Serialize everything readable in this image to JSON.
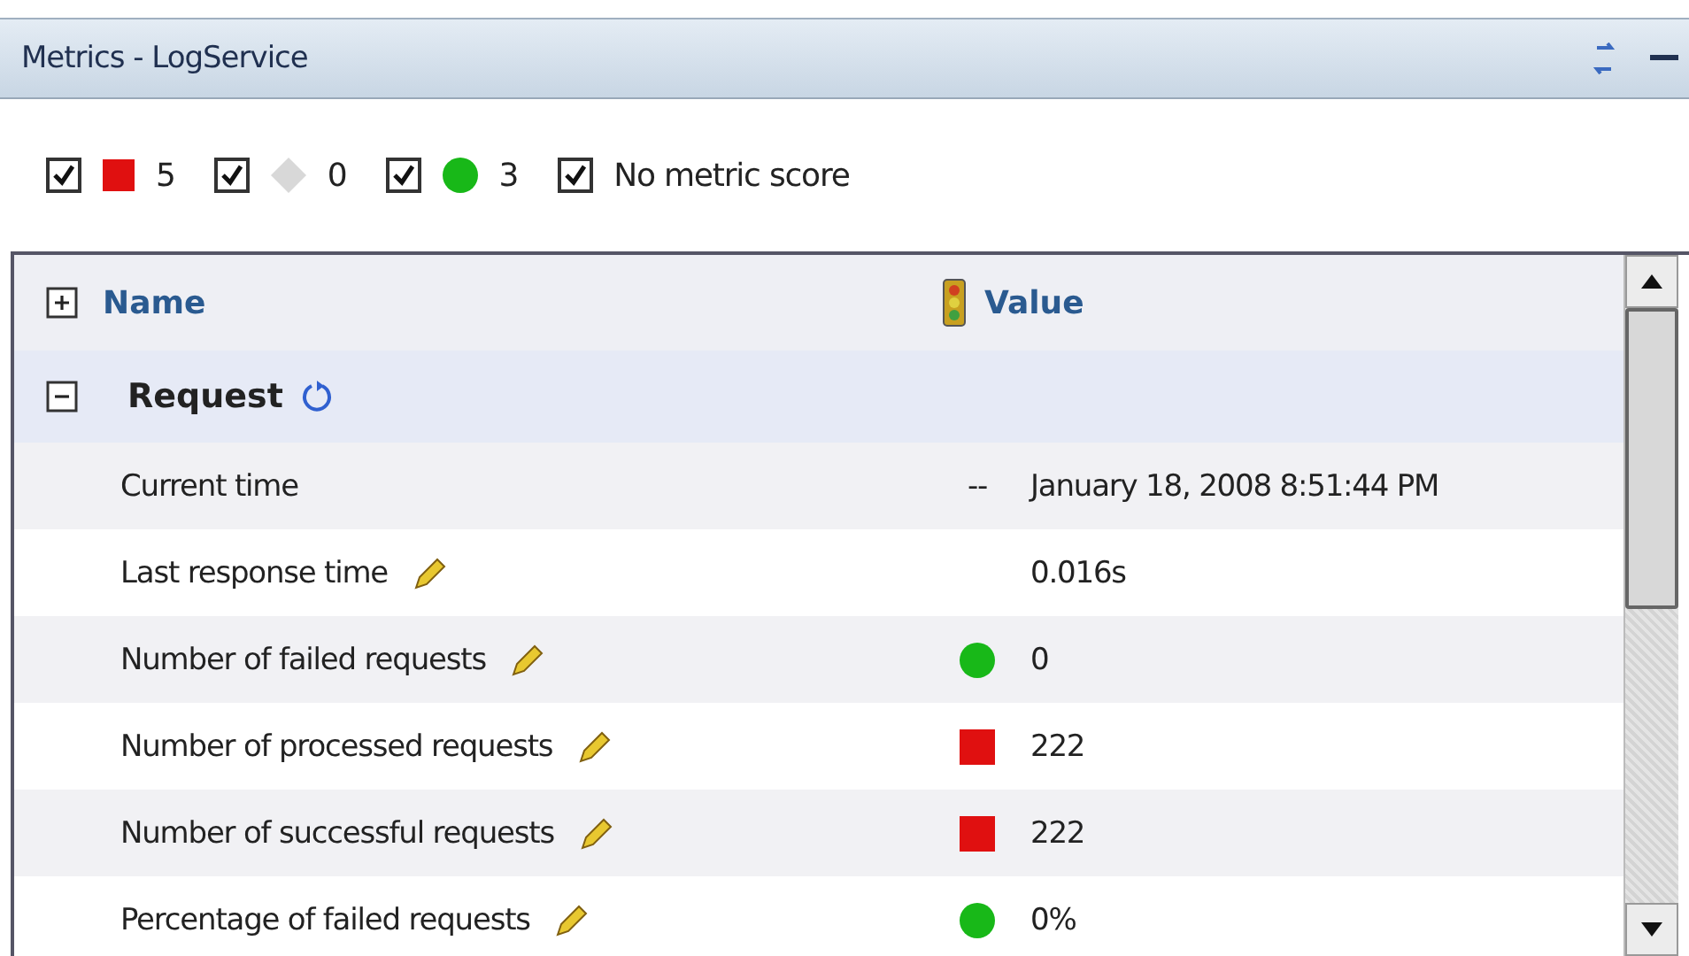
{
  "window": {
    "title": "Metrics - LogService"
  },
  "filters": [
    {
      "checked": true,
      "kind": "square",
      "color": "#e01010",
      "count": "5"
    },
    {
      "checked": true,
      "kind": "diamond",
      "color": "#d8d8d8",
      "count": "0"
    },
    {
      "checked": true,
      "kind": "circle",
      "color": "#18b818",
      "count": "3"
    },
    {
      "checked": true,
      "kind": "text",
      "label": "No metric score"
    }
  ],
  "table": {
    "columns": [
      "Name",
      "Value"
    ],
    "groups": [
      {
        "name": "Request",
        "expanded": true,
        "rows": [
          {
            "name": "Current time",
            "editable": false,
            "kind": "dashes",
            "score_text": "--",
            "value": "January 18, 2008 8:51:44 PM"
          },
          {
            "name": "Last response time",
            "editable": true,
            "kind": "blank",
            "value": "0.016s"
          },
          {
            "name": "Number of failed requests",
            "editable": true,
            "kind": "circle",
            "color": "#18b818",
            "value": "0"
          },
          {
            "name": "Number of processed requests",
            "editable": true,
            "kind": "square",
            "color": "#e01010",
            "value": "222"
          },
          {
            "name": "Number of successful requests",
            "editable": true,
            "kind": "square",
            "color": "#e01010",
            "value": "222"
          },
          {
            "name": "Percentage of failed requests",
            "editable": true,
            "kind": "circle",
            "color": "#18b818",
            "value": "0%"
          }
        ]
      }
    ]
  }
}
